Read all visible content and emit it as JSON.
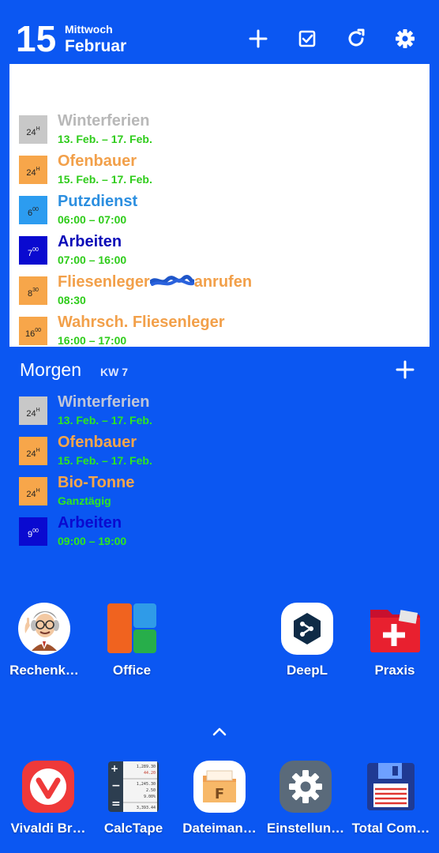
{
  "header": {
    "day_number": "15",
    "weekday": "Mittwoch",
    "month": "Februar"
  },
  "today_events": [
    {
      "badge_num": "24",
      "badge_sup": "H",
      "badge_color": "#c8c8c8",
      "title": "Winterferien",
      "title_color": "#b8b8b8",
      "time": "13. Feb. – 17. Feb."
    },
    {
      "badge_num": "24",
      "badge_sup": "H",
      "badge_color": "#f7a64a",
      "title": "Ofenbauer",
      "title_color": "#f2a04a",
      "time": "15. Feb. – 17. Feb."
    },
    {
      "badge_num": "6",
      "badge_sup": "00",
      "badge_color": "#2c9cf0",
      "title": "Putzdienst",
      "title_color": "#2c8fe0",
      "time": "06:00 – 07:00"
    },
    {
      "badge_num": "7",
      "badge_sup": "00",
      "badge_color": "#0a0ad0",
      "title": "Arbeiten",
      "title_color": "#0a0ab8",
      "time": "07:00 – 16:00"
    },
    {
      "badge_num": "8",
      "badge_sup": "30",
      "badge_color": "#f7a64a",
      "title": "Fliesenleger",
      "title_tail": "anrufen",
      "title_color": "#f2a04a",
      "time": "08:30"
    },
    {
      "badge_num": "16",
      "badge_sup": "00",
      "badge_color": "#f7a64a",
      "title": "Wahrsch. Fliesenleger",
      "title_color": "#f2a04a",
      "time": "16:00 – 17:00"
    }
  ],
  "tomorrow": {
    "heading": "Morgen",
    "week_label": "KW 7",
    "events": [
      {
        "badge_num": "24",
        "badge_sup": "H",
        "badge_color": "#c8c8c8",
        "title": "Winterferien",
        "title_color": "#c0c6d8",
        "time": "13. Feb. – 17. Feb."
      },
      {
        "badge_num": "24",
        "badge_sup": "H",
        "badge_color": "#f7a64a",
        "title": "Ofenbauer",
        "title_color": "#f7a64a",
        "time": "15. Feb. – 17. Feb."
      },
      {
        "badge_num": "24",
        "badge_sup": "H",
        "badge_color": "#f7a64a",
        "title": "Bio-Tonne",
        "title_color": "#f7a64a",
        "time": "Ganztägig"
      },
      {
        "badge_num": "9",
        "badge_sup": "00",
        "badge_color": "#0a0ad0",
        "title": "Arbeiten",
        "title_color": "#0a0ad0",
        "time": "09:00 – 19:00"
      }
    ]
  },
  "apps_row": [
    {
      "label": "Rechenk…",
      "icon": "professor-icon"
    },
    {
      "label": "Office",
      "icon": "office-icon"
    },
    {
      "label": "DeepL",
      "icon": "deepl-icon"
    },
    {
      "label": "Praxis",
      "icon": "praxis-folder-icon"
    }
  ],
  "dock": [
    {
      "label": "Vivaldi Br…",
      "icon": "vivaldi-icon"
    },
    {
      "label": "CalcTape",
      "icon": "calctape-icon"
    },
    {
      "label": "Dateiman…",
      "icon": "file-manager-icon"
    },
    {
      "label": "Einstellun…",
      "icon": "settings-gear-icon"
    },
    {
      "label": "Total Com…",
      "icon": "floppy-disk-icon"
    }
  ],
  "calctape_preview": [
    "1,289.30",
    "44.20",
    "1,245.30",
    "2.50",
    "9.00%",
    "3,393.44"
  ],
  "colors": {
    "wallpaper": "#0b57f2",
    "panel": "#ffffff",
    "time_green": "#2ecc1a"
  }
}
